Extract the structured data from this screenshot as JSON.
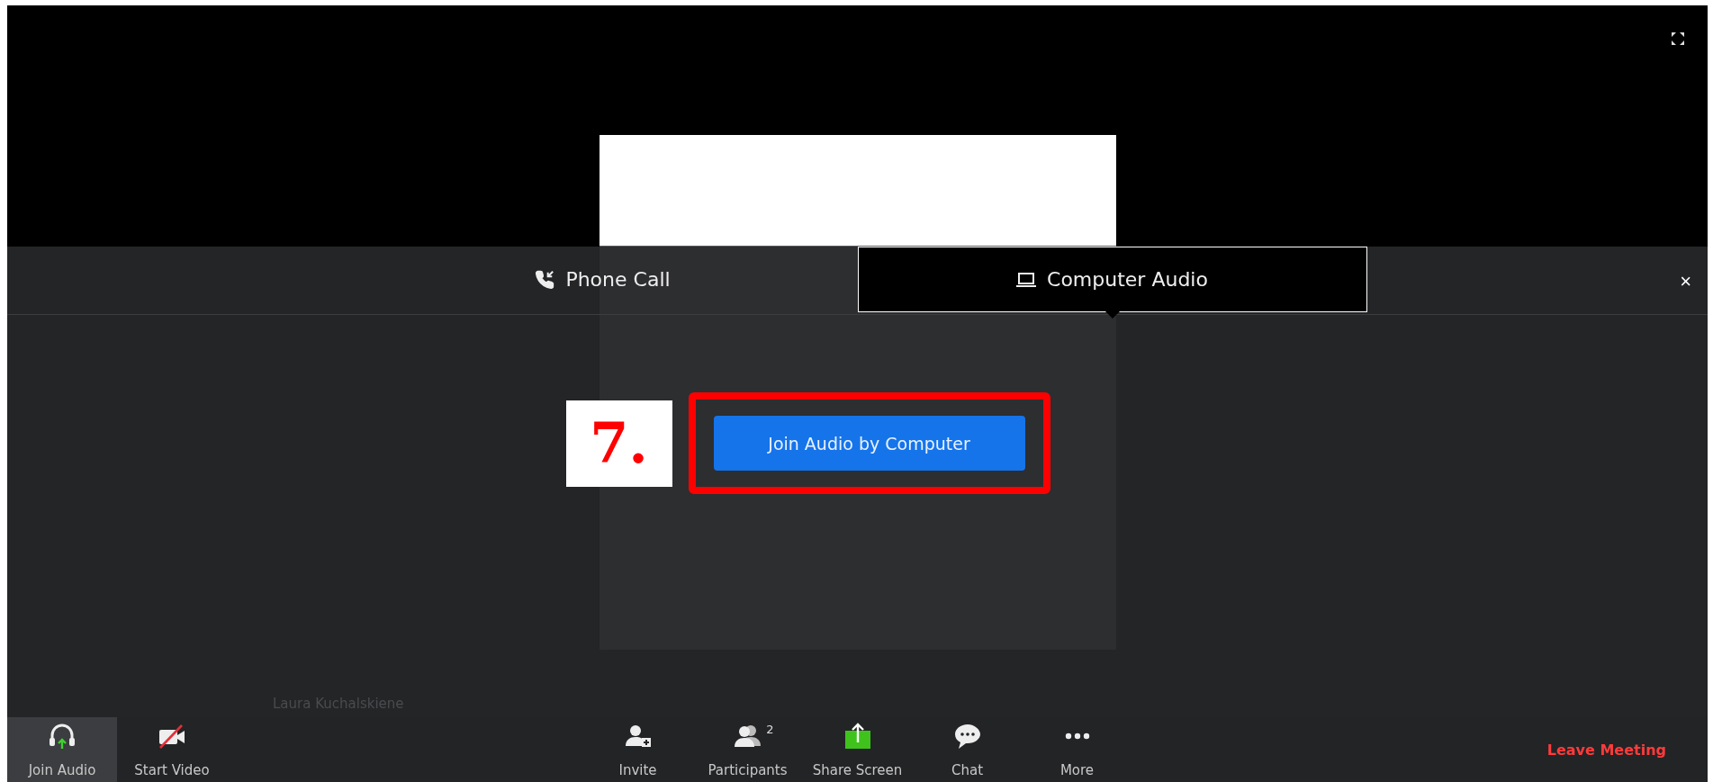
{
  "tabs": [
    {
      "label": "Phone Call",
      "kind": "phone",
      "selected": false
    },
    {
      "label": "Computer Audio",
      "kind": "laptop",
      "selected": true
    }
  ],
  "close": "×",
  "annotation": {
    "label": "7."
  },
  "join_button": {
    "label": "Join Audio by Computer"
  },
  "participant_name": "Laura Kuchalskiene",
  "toolbar": {
    "left": [
      {
        "label": "Join Audio",
        "kind": "headphones",
        "selected": true
      },
      {
        "label": "Start Video",
        "kind": "video",
        "selected": false
      }
    ],
    "center": [
      {
        "label": "Invite",
        "kind": "invite"
      },
      {
        "label": "Participants",
        "kind": "participants",
        "count": "2"
      },
      {
        "label": "Share Screen",
        "kind": "share"
      },
      {
        "label": "Chat",
        "kind": "chat"
      },
      {
        "label": "More",
        "kind": "more"
      }
    ],
    "leave": "Leave Meeting"
  }
}
